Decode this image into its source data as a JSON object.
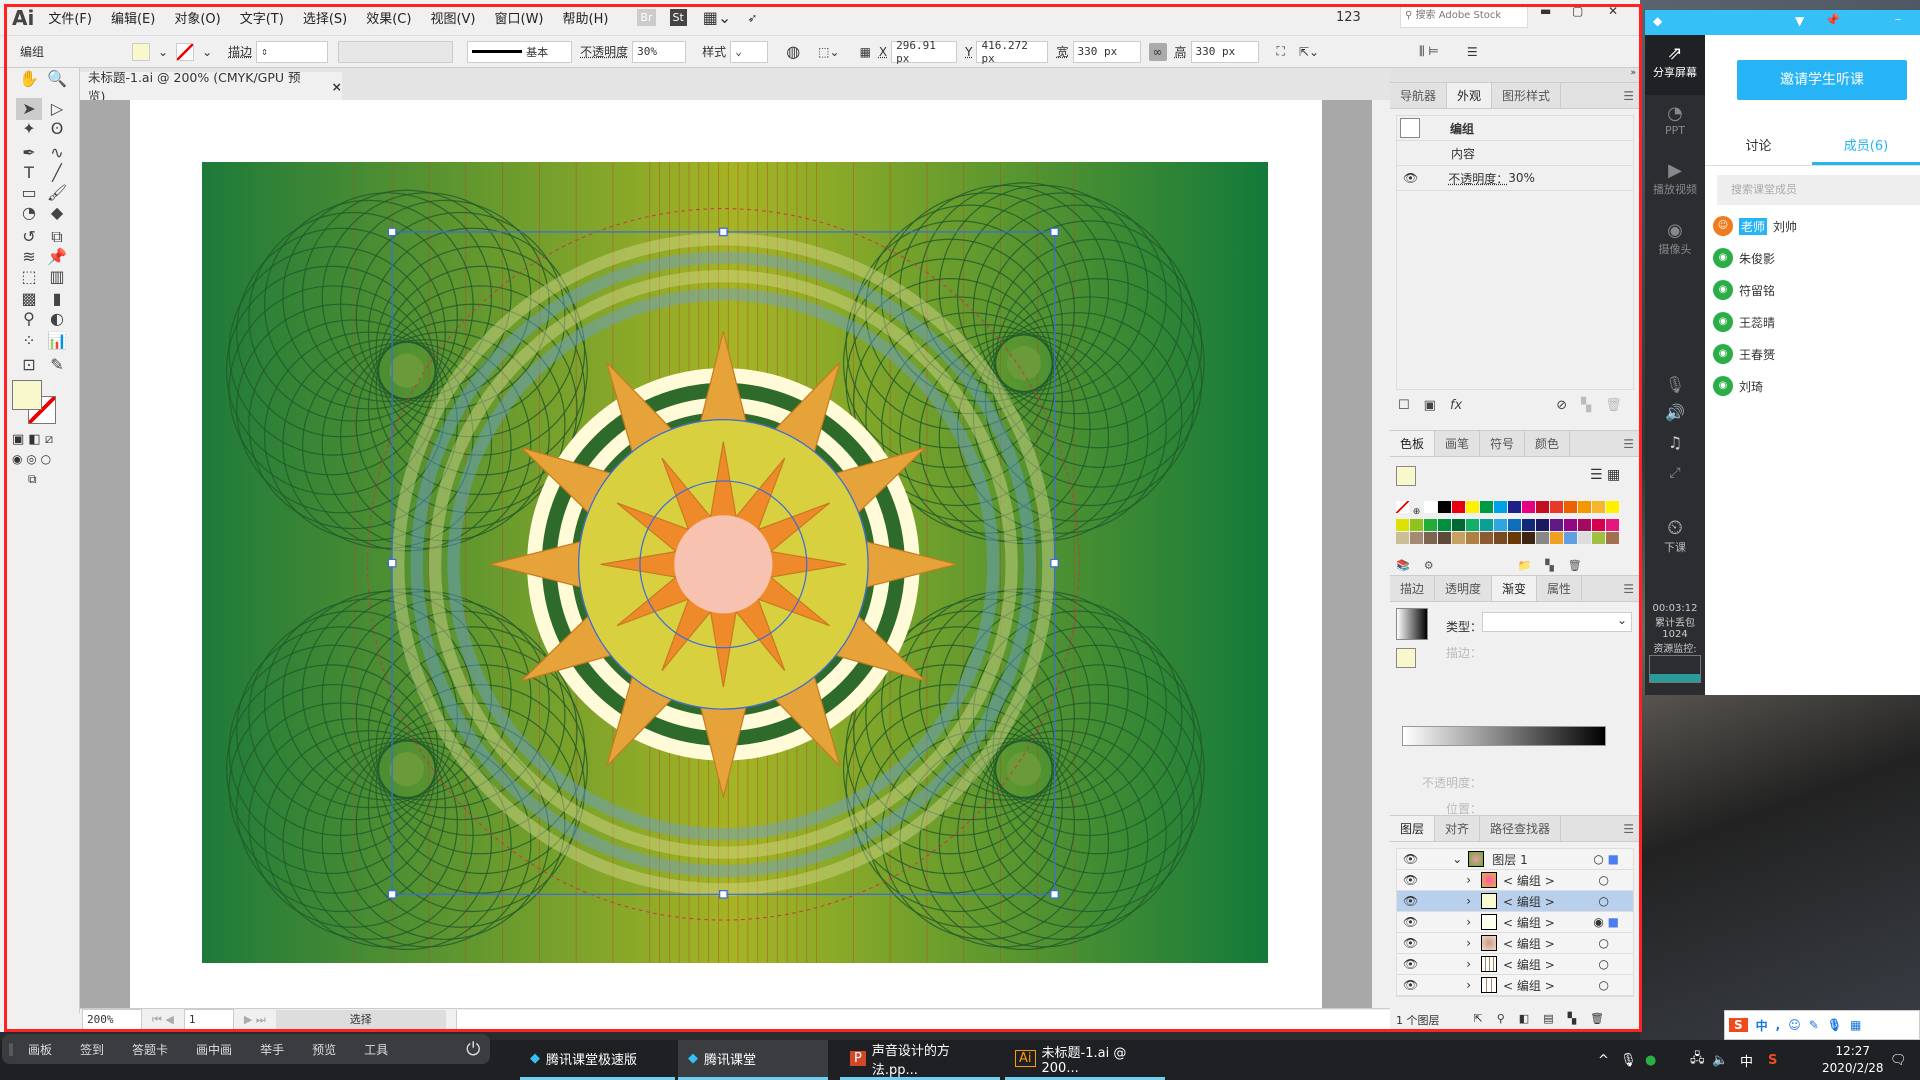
{
  "ai": {
    "logo": "Ai",
    "menus": [
      "文件(F)",
      "编辑(E)",
      "对象(O)",
      "文字(T)",
      "选择(S)",
      "效果(C)",
      "视图(V)",
      "窗口(W)",
      "帮助(H)"
    ],
    "bridge": "Br",
    "stock": "St",
    "workspace": "123",
    "search_placeholder": "搜索 Adobe Stock",
    "control": {
      "selection": "编组",
      "stroke_label": "描边",
      "stroke_profile": "基本",
      "opacity_label": "不透明度",
      "opacity": "30%",
      "style_label": "样式",
      "x_label": "X",
      "x": "296.91 px",
      "y_label": "Y",
      "y": "416.272 px",
      "w_label": "宽",
      "w": "330 px",
      "h_label": "高",
      "h": "330 px"
    },
    "document_tab": "未标题-1.ai @ 200% (CMYK/GPU 预览)",
    "status": {
      "zoom": "200%",
      "artboard": "1",
      "tool": "选择"
    },
    "colors": {
      "fill": "#f8f8cc",
      "bg_start": "#1e7a3a",
      "bg_mid": "#a5b424",
      "star": "#e89a3a",
      "selection": "#3a6be0"
    }
  },
  "appearance": {
    "tabs": [
      "导航器",
      "外观",
      "图形样式"
    ],
    "active": 1,
    "rows": [
      "编组",
      "内容",
      "不透明度：",
      "30%"
    ]
  },
  "swatches": {
    "tabs": [
      "色板",
      "画笔",
      "符号",
      "颜色"
    ],
    "colors": [
      "#ffffff",
      "#000000",
      "#e60012",
      "#fff100",
      "#009944",
      "#00a0e9",
      "#1d2088",
      "#e4007f",
      "#c30d23",
      "#e73828",
      "#eb6100",
      "#f39800",
      "#f8b62d",
      "#fff100",
      "#dde100",
      "#8fc31f",
      "#22ac38",
      "#009140",
      "#006934",
      "#13ae67",
      "#0aa096",
      "#2ea7e0",
      "#0e6eb8",
      "#13287b",
      "#1a1a5e",
      "#601986",
      "#920783",
      "#a30b5e",
      "#d7004f",
      "#e4187a",
      "#cbbd98",
      "#a38a72",
      "#7b6551",
      "#5f4a3a",
      "#c8a063",
      "#b08043",
      "#8e5b30",
      "#7a4a20",
      "#6a3906",
      "#3e2512",
      "#888888",
      "#f0a020",
      "#60a0e0",
      "#dddddd",
      "#a0c040",
      "#a07050"
    ]
  },
  "gradient": {
    "tabs": [
      "描边",
      "透明度",
      "渐变",
      "属性"
    ],
    "type_label": "类型：",
    "stroke_label": "描边：",
    "opacity_label": "不透明度：",
    "position_label": "位置："
  },
  "layers": {
    "tabs": [
      "图层",
      "对齐",
      "路径查找器"
    ],
    "layer_name": "图层 1",
    "items": [
      "< 编组 >",
      "< 编组 >",
      "< 编组 >",
      "< 编组 >",
      "< 编组 >",
      "< 编组 >"
    ],
    "footer": "1 个图层"
  },
  "tencent": {
    "invite": "邀请学生听课",
    "tabs": [
      "讨论",
      "成员(6)"
    ],
    "search_placeholder": "搜索课堂成员",
    "teacher_badge": "老师",
    "members": [
      "刘帅",
      "朱俊影",
      "符留铭",
      "王蕊晴",
      "王春赟",
      "刘琦"
    ],
    "side": [
      "分享屏幕",
      "PPT",
      "播放视频",
      "摄像头",
      "下课"
    ],
    "timer": "00:03:12",
    "loss_label": "累计丢包",
    "loss": "1024",
    "monitor": "资源监控:"
  },
  "floatbar": [
    "画板",
    "签到",
    "答题卡",
    "画中画",
    "举手",
    "预览",
    "工具"
  ],
  "taskbar": {
    "apps": [
      "腾讯课堂极速版",
      "腾讯课堂",
      "声音设计的方法.pp...",
      "未标题-1.ai @ 200..."
    ],
    "ime": "中",
    "time": "12:27",
    "date": "2020/2/28"
  }
}
